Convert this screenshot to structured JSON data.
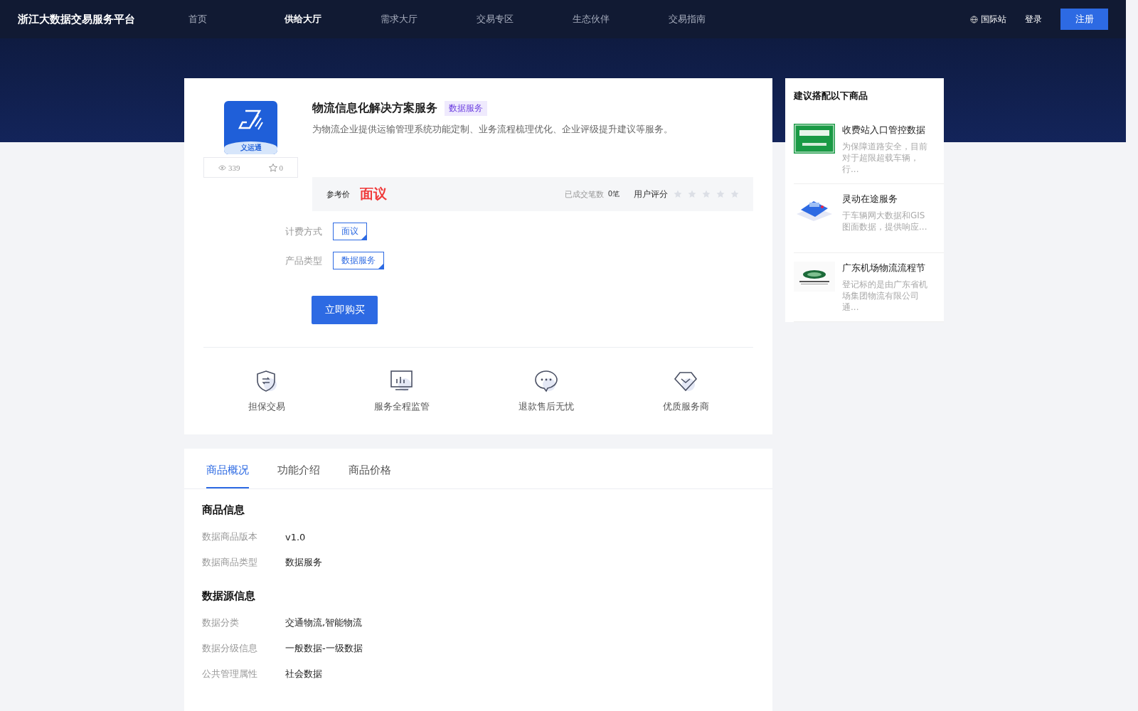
{
  "header": {
    "logo": "浙江大数据交易服务平台",
    "nav": [
      {
        "label": "首页",
        "selected": false
      },
      {
        "label": "供给大厅",
        "selected": true
      },
      {
        "label": "需求大厅",
        "selected": false
      },
      {
        "label": "交易专区",
        "selected": false
      },
      {
        "label": "生态伙伴",
        "selected": false
      },
      {
        "label": "交易指南",
        "selected": false
      }
    ],
    "intl": "国际站",
    "login": "登录",
    "register": "注册"
  },
  "product": {
    "logo_text": "义运通",
    "views": "339",
    "favorites": "0",
    "title": "物流信息化解决方案服务",
    "tag": "数据服务",
    "description": "为物流企业提供运输管理系统功能定制、业务流程梳理优化、企业评级提升建议等服务。",
    "price_label": "参考价",
    "price": "面议",
    "deals_label": "已成交笔数",
    "deals": "0笔",
    "rating_label": "用户评分",
    "stars": 0,
    "options": [
      {
        "label": "计费方式",
        "value": "面议"
      },
      {
        "label": "产品类型",
        "value": "数据服务"
      }
    ],
    "buy": "立即购买",
    "features": [
      {
        "kind": "shield",
        "label": "担保交易"
      },
      {
        "kind": "monitor",
        "label": "服务全程监管"
      },
      {
        "kind": "chat",
        "label": "退款售后无忧"
      },
      {
        "kind": "diamond",
        "label": "优质服务商"
      }
    ]
  },
  "tabs": [
    {
      "label": "商品概况",
      "selected": true
    },
    {
      "label": "功能介绍",
      "selected": false
    },
    {
      "label": "商品价格",
      "selected": false
    }
  ],
  "sections": [
    {
      "title": "商品信息",
      "rows": [
        {
          "label": "数据商品版本",
          "value": "v1.0"
        },
        {
          "label": "数据商品类型",
          "value": "数据服务"
        }
      ]
    },
    {
      "title": "数据源信息",
      "rows": [
        {
          "label": "数据分类",
          "value": "交通物流,智能物流"
        },
        {
          "label": "数据分级信息",
          "value": "一般数据-一级数据"
        },
        {
          "label": "公共管理属性",
          "value": "社会数据"
        }
      ]
    }
  ],
  "sidebar": {
    "title": "建议搭配以下商品",
    "items": [
      {
        "kind": "picture",
        "name": "收费站入口管控数据",
        "desc": "为保障道路安全，目前对于超限超载车辆，行..."
      },
      {
        "kind": "picture",
        "name": "灵动在途服务",
        "desc": "于车辆网大数据和GIS图面数据，提供响应..."
      },
      {
        "kind": "picture",
        "name": "广东机场物流流程节",
        "desc": "登记标的是由广东省机场集团物流有限公司通..."
      }
    ]
  }
}
